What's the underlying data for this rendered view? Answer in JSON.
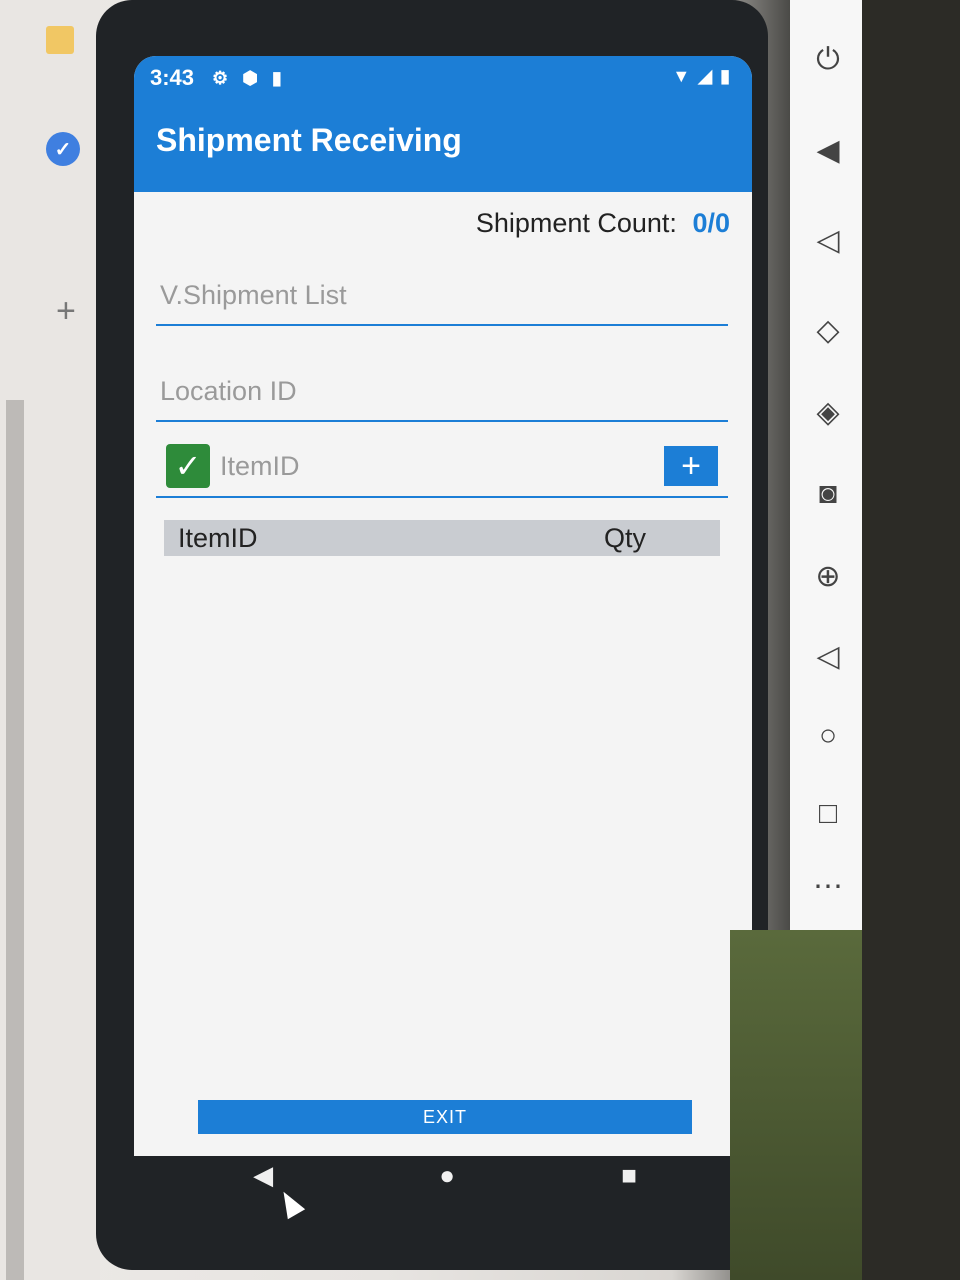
{
  "status_bar": {
    "time": "3:43",
    "icons": [
      "gear-icon",
      "shield-icon",
      "sdcard-icon"
    ],
    "right_icons": [
      "wifi-icon",
      "signal-icon",
      "battery-icon"
    ]
  },
  "app_bar": {
    "title": "Shipment Receiving"
  },
  "shipment_count": {
    "label": "Shipment Count:",
    "value": "0/0"
  },
  "fields": {
    "shipment_list": {
      "placeholder": "V.Shipment List",
      "value": ""
    },
    "location_id": {
      "placeholder": "Location ID",
      "value": ""
    },
    "item_id": {
      "placeholder": "ItemID",
      "value": "",
      "checked": true
    }
  },
  "add_button": {
    "label": "+"
  },
  "table": {
    "columns": [
      "ItemID",
      "Qty"
    ],
    "rows": []
  },
  "exit_button": {
    "label": "EXIT"
  },
  "nav": {
    "back": "◀",
    "home": "●",
    "recents": "■"
  },
  "emulator_toolbar": {
    "items": [
      "power-icon",
      "volume-up-icon",
      "volume-down-icon",
      "rotate-left-icon",
      "rotate-right-icon",
      "camera-icon",
      "zoom-icon",
      "back-icon",
      "home-icon",
      "overview-icon",
      "more-icon"
    ]
  },
  "colors": {
    "accent": "#1c7ed6",
    "checkbox": "#2e8b3a",
    "table_header": "#c9ccd1"
  }
}
